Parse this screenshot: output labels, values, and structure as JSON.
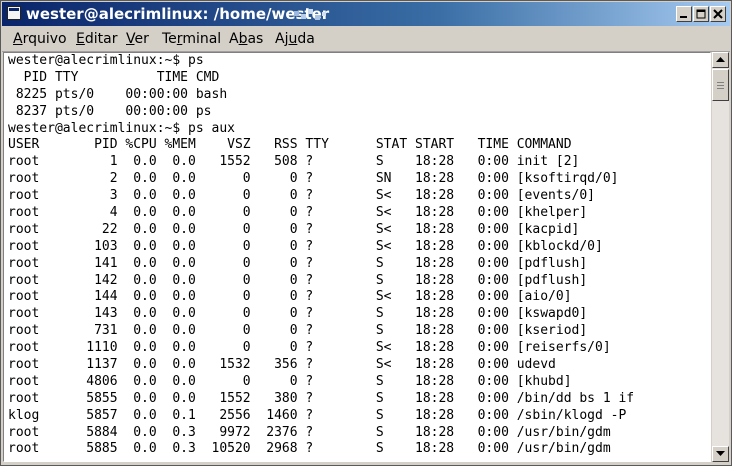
{
  "window": {
    "title": "wester@alecrimlinux: /home/wester",
    "icons": {
      "app": "terminal-app-icon",
      "minimize": "minimize-icon",
      "maximize": "maximize-icon",
      "close": "close-icon"
    }
  },
  "menubar": {
    "items": [
      {
        "mnemonic": "A",
        "rest": "rquivo"
      },
      {
        "mnemonic": "E",
        "rest": "ditar"
      },
      {
        "mnemonic": "V",
        "rest": "er"
      },
      {
        "pre": "Te",
        "mnemonic": "r",
        "rest": "minal"
      },
      {
        "pre": "A",
        "mnemonic": "b",
        "rest": "as"
      },
      {
        "pre": "Aj",
        "mnemonic": "u",
        "rest": "da"
      }
    ]
  },
  "terminal": {
    "lines": [
      "wester@alecrimlinux:~$ ps",
      "  PID TTY          TIME CMD",
      " 8225 pts/0    00:00:00 bash",
      " 8237 pts/0    00:00:00 ps",
      "wester@alecrimlinux:~$ ps aux",
      "USER       PID %CPU %MEM    VSZ   RSS TTY      STAT START   TIME COMMAND",
      "root         1  0.0  0.0   1552   508 ?        S    18:28   0:00 init [2]",
      "root         2  0.0  0.0      0     0 ?        SN   18:28   0:00 [ksoftirqd/0]",
      "root         3  0.0  0.0      0     0 ?        S<   18:28   0:00 [events/0]",
      "root         4  0.0  0.0      0     0 ?        S<   18:28   0:00 [khelper]",
      "root        22  0.0  0.0      0     0 ?        S<   18:28   0:00 [kacpid]",
      "root       103  0.0  0.0      0     0 ?        S<   18:28   0:00 [kblockd/0]",
      "root       141  0.0  0.0      0     0 ?        S    18:28   0:00 [pdflush]",
      "root       142  0.0  0.0      0     0 ?        S    18:28   0:00 [pdflush]",
      "root       144  0.0  0.0      0     0 ?        S<   18:28   0:00 [aio/0]",
      "root       143  0.0  0.0      0     0 ?        S    18:28   0:00 [kswapd0]",
      "root       731  0.0  0.0      0     0 ?        S    18:28   0:00 [kseriod]",
      "root      1110  0.0  0.0      0     0 ?        S<   18:28   0:00 [reiserfs/0]",
      "root      1137  0.0  0.0   1532   356 ?        S<   18:28   0:00 udevd",
      "root      4806  0.0  0.0      0     0 ?        S    18:28   0:00 [khubd]",
      "root      5855  0.0  0.0   1552   380 ?        S    18:28   0:00 /bin/dd bs 1 if",
      "klog      5857  0.0  0.1   2556  1460 ?        S    18:28   0:00 /sbin/klogd -P",
      "root      5884  0.0  0.3   9972  2376 ?        S    18:28   0:00 /usr/bin/gdm",
      "root      5885  0.0  0.3  10520  2968 ?        S    18:28   0:00 /usr/bin/gdm"
    ]
  },
  "scrollbar": {
    "up_icon": "arrow-up-icon",
    "down_icon": "arrow-down-icon"
  }
}
